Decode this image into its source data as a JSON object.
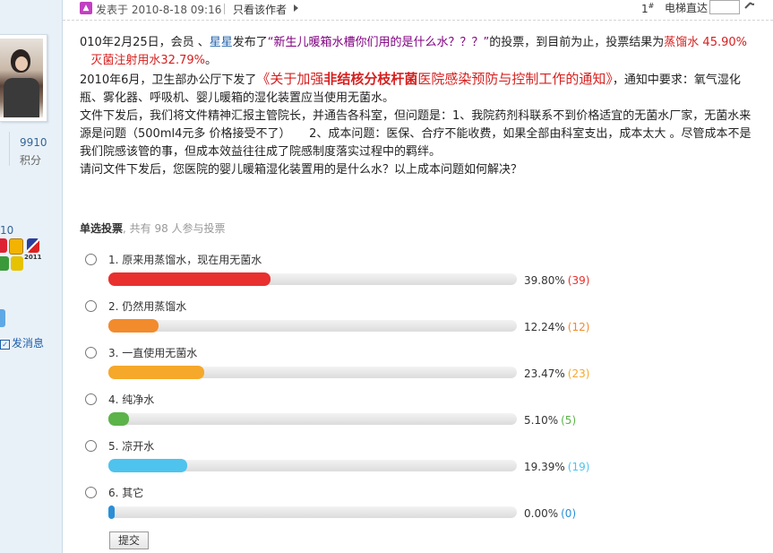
{
  "post": {
    "posted_prefix": "发表于",
    "posted_time": "2010-8-18 09:16",
    "only_author": "只看该作者",
    "floor_number": "1",
    "floor_sup": "#",
    "elevator_label": "电梯直达",
    "elevator_value": ""
  },
  "author": {
    "stat_value": "9910",
    "stat_label": "积分",
    "side_number": "10",
    "medal_text": "2011",
    "send_message": "发消息"
  },
  "body": {
    "p1": {
      "date": "010年2月25日，会员 、",
      "user": "星星",
      "published": "发布了",
      "poll_link": "“新生儿暖箱水槽你们用的是什么水？？？”",
      "after_link": "的投票，到目前为止，投票结果为",
      "result1": "蒸馏水 45.90%",
      "gap": "   ",
      "result2": "灭菌注射用水32.79%",
      "end": "。"
    },
    "p2": {
      "lead": "2010年6月，卫生部办公厅下发了",
      "doc_open": "《关于加强",
      "doc_bold": "非结核分枝杆菌",
      "doc_tail": "医院感染预防与控制工作的通知",
      "doc_close": "》",
      "after": "，通知中要求：氧气湿化瓶、雾化器、呼吸机、婴儿暖箱的湿化装置应当使用无菌水。"
    },
    "p3": "文件下发后，我们将文件精神汇报主管院长，并通告各科室，但问题是：1、我院药剂科联系不到价格适宜的无菌水厂家，无菌水来源是问题（500ml4元多 价格接受不了）     2、成本问题：医保、合疗不能收费，如果全部由科室支出，成本太大 。尽管成本不是我们院感该管的事，但成本效益往往成了院感制度落实过程中的羁绊。",
    "p4": "请问文件下发后，您医院的婴儿暖箱湿化装置用的是什么水？以上成本问题如何解决？"
  },
  "poll": {
    "type_label": "单选投票",
    "participants": ", 共有 98 人参与投票",
    "submit_label": "提交",
    "options": [
      {
        "label": "1.  原来用蒸馏水，现在用无菌水",
        "percent": "39.80%",
        "count": "(39)",
        "fraction": 0.398,
        "color": "#e8302f",
        "count_color": "#e8302f"
      },
      {
        "label": "2.  仍然用蒸馏水",
        "percent": "12.24%",
        "count": "(12)",
        "fraction": 0.1224,
        "color": "#f28b2c",
        "count_color": "#f28b2c"
      },
      {
        "label": "3.  一直使用无菌水",
        "percent": "23.47%",
        "count": "(23)",
        "fraction": 0.2347,
        "color": "#f5a82a",
        "count_color": "#f5a82a"
      },
      {
        "label": "4.  纯净水",
        "percent": "5.10%",
        "count": "(5)",
        "fraction": 0.051,
        "color": "#5cb34a",
        "count_color": "#5cb34a"
      },
      {
        "label": "5.  凉开水",
        "percent": "19.39%",
        "count": "(19)",
        "fraction": 0.1939,
        "color": "#4ec3ee",
        "count_color": "#4ec3ee"
      },
      {
        "label": "6.  其它",
        "percent": "0.00%",
        "count": "(0)",
        "fraction": 0.0,
        "color": "#2a8fd6",
        "count_color": "#2a8fd6"
      }
    ]
  }
}
